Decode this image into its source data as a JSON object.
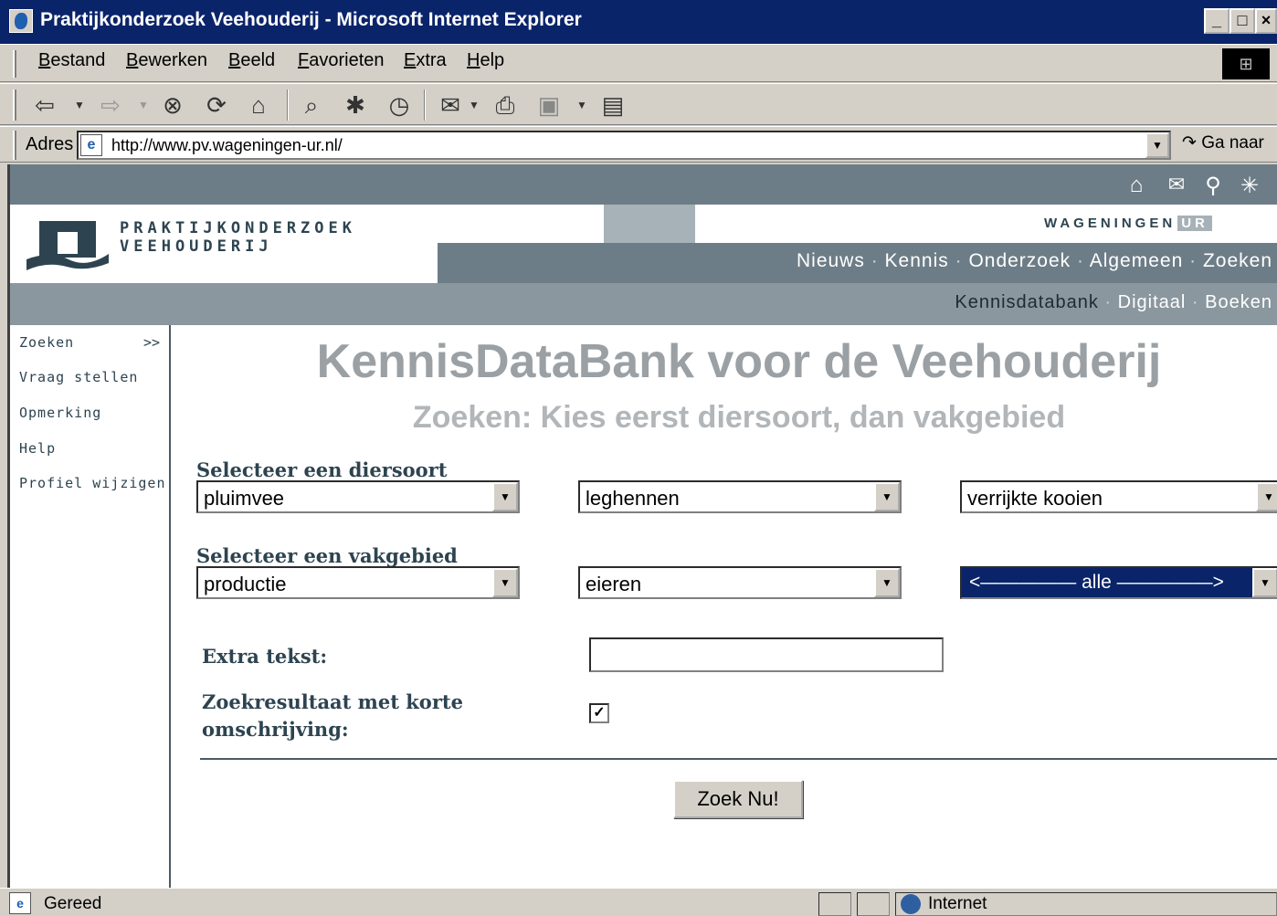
{
  "window": {
    "title": "Praktijkonderzoek Veehouderij - Microsoft Internet Explorer",
    "controls": [
      "_",
      "□",
      "×"
    ]
  },
  "menu": {
    "items": [
      {
        "label": "Bestand"
      },
      {
        "label": "Bewerken"
      },
      {
        "label": "Beeld"
      },
      {
        "label": "Favorieten"
      },
      {
        "label": "Extra"
      },
      {
        "label": "Help"
      }
    ]
  },
  "toolbar": {
    "icons": [
      "back-icon",
      "forward-icon",
      "stop-icon",
      "refresh-icon",
      "home-icon",
      "search-icon",
      "favorites-icon",
      "history-icon",
      "mail-icon",
      "print-icon",
      "edit-icon",
      "discuss-icon"
    ]
  },
  "address": {
    "label": "Adres",
    "url": "http://www.pv.wageningen-ur.nl/",
    "go_label": "Ga naar"
  },
  "site": {
    "top_icons": [
      "home-icon",
      "mail-icon",
      "search-icon",
      "sitemap-icon"
    ],
    "logo_line1": "PRAKTIJKONDERZOEK",
    "logo_line2": "VEEHOUDERIJ",
    "wur_text": "WAGENINGEN",
    "wur_badge": "UR",
    "main_nav": [
      "Nieuws",
      "Kennis",
      "Onderzoek",
      "Algemeen",
      "Zoeken"
    ],
    "sub_nav": [
      "Kennisdatabank",
      "Digitaal",
      "Boeken"
    ],
    "nav_separator": "·"
  },
  "sidebar": {
    "items": [
      {
        "label": "Zoeken",
        "arrow": ">>"
      },
      {
        "label": "Vraag stellen"
      },
      {
        "label": "Opmerking"
      },
      {
        "label": "Help"
      },
      {
        "label": "Profiel wijzigen"
      }
    ]
  },
  "main": {
    "title": "KennisDataBank voor de Veehouderij",
    "subtitle": "Zoeken: Kies eerst diersoort, dan vakgebied",
    "diersoort_label": "Selecteer een diersoort",
    "diersoort_selects": [
      "pluimvee",
      "leghennen",
      "verrijkte kooien"
    ],
    "vakgebied_label": "Selecteer een vakgebied",
    "vakgebied_selects": [
      "productie",
      "eieren",
      "<————— alle —————>"
    ],
    "extra_label": "Extra tekst:",
    "extra_value": "",
    "summary_label_line1": "Zoekresultaat met korte",
    "summary_label_line2": "omschrijving:",
    "summary_checked": true,
    "submit_label": "Zoek Nu!"
  },
  "status": {
    "text": "Gereed",
    "zone": "Internet"
  }
}
